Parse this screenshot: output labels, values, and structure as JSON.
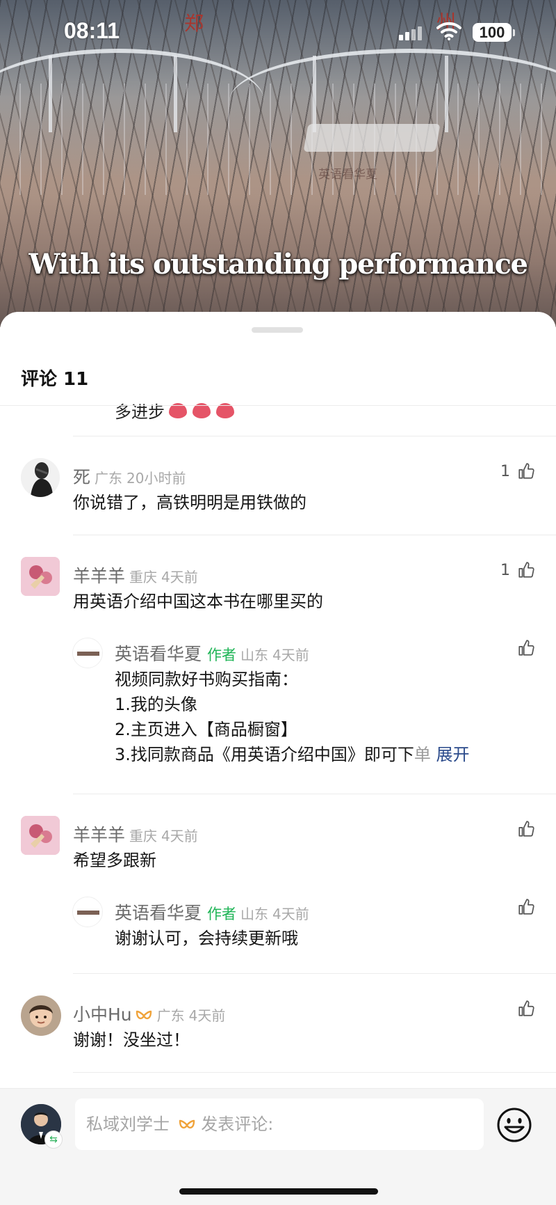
{
  "status_bar": {
    "time": "08:11",
    "battery": "100"
  },
  "video": {
    "station_sign_left": "郑",
    "station_sign_right": "州",
    "watermark": "英语看华夏",
    "subtitle": "With its outstanding performance"
  },
  "sheet": {
    "title": "评论 11",
    "partial_text": "多进步"
  },
  "comments": [
    {
      "name": "死",
      "location": "广东",
      "time": "20小时前",
      "text": "你说错了，高铁明明是用铁做的",
      "likes": "1"
    },
    {
      "name": "羊羊羊",
      "location": "重庆",
      "time": "4天前",
      "text": "用英语介绍中国这本书在哪里买的",
      "likes": "1",
      "reply": {
        "name": "英语看华夏",
        "tag": "作者",
        "location": "山东",
        "time": "4天前",
        "lines": [
          "视频同款好书购买指南：",
          "1.我的头像",
          "2.主页进入【商品橱窗】"
        ],
        "last_line": "3.找同款商品《用英语介绍中国》即可下",
        "last_line_fade": "单",
        "expand": "展开"
      }
    },
    {
      "name": "羊羊羊",
      "location": "重庆",
      "time": "4天前",
      "text": "希望多跟新",
      "reply": {
        "name": "英语看华夏",
        "tag": "作者",
        "location": "山东",
        "time": "4天前",
        "text": "谢谢认可，会持续更新哦"
      }
    },
    {
      "name": "小中Hu",
      "location": "广东",
      "time": "4天前",
      "text": "谢谢！没坐过！"
    }
  ],
  "input": {
    "placeholder_name": "私域刘学士",
    "placeholder_suffix": "发表评论:"
  },
  "icons": {
    "like": "thumbs-up-icon",
    "emoji": "smiley-icon",
    "vip": "vip-badge-icon",
    "swap": "swap-icon"
  },
  "colors": {
    "author_tag": "#20b557",
    "expand_link": "#2a4a8b",
    "vip_badge": "#f0a33a",
    "heart": "#e55467"
  }
}
